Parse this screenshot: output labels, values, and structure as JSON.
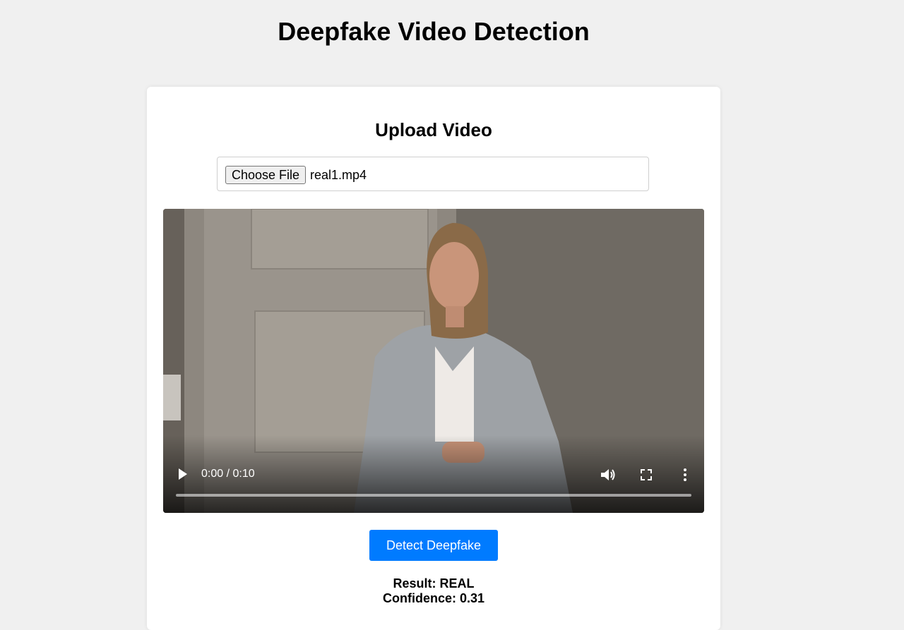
{
  "page": {
    "title": "Deepfake Video Detection"
  },
  "upload": {
    "heading": "Upload Video",
    "choose_button": "Choose File",
    "file_name": "real1.mp4"
  },
  "video": {
    "time": "0:00 / 0:10",
    "progress": 0,
    "icons": {
      "play": "play-icon",
      "volume": "volume-icon",
      "fullscreen": "fullscreen-icon",
      "more": "more-options-icon"
    }
  },
  "actions": {
    "detect_button": "Detect Deepfake"
  },
  "result": {
    "result_text": "Result: REAL",
    "confidence_text": "Confidence: 0.31"
  },
  "colors": {
    "background": "#f0f0f0",
    "card": "#ffffff",
    "accent": "#007bff"
  }
}
